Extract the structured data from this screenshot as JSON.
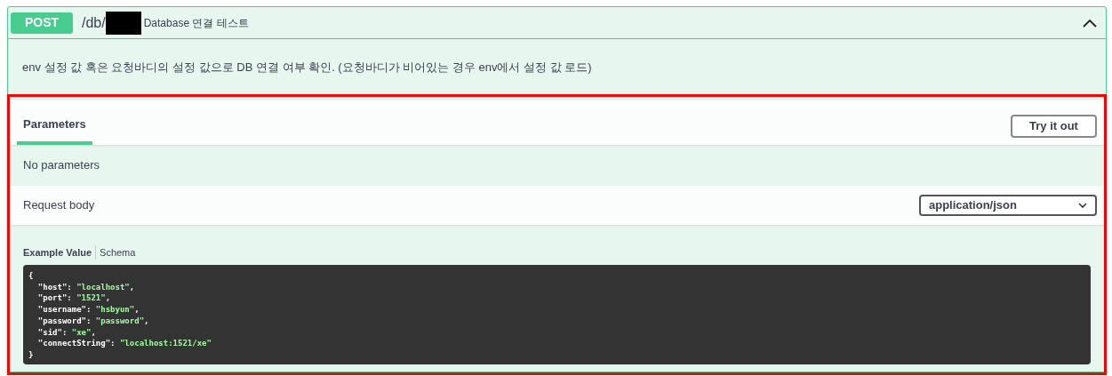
{
  "operation": {
    "method": "POST",
    "path": "/db/",
    "path_redacted": true,
    "summary": "Database 연결 테스트",
    "expanded": true
  },
  "description": "env 설정 값 혹은 요청바디의 설정 값으로 DB 연결 여부 확인. (요청바디가 비어있는 경우 env에서 설정 값 로드)",
  "tabs": [
    {
      "label": "Parameters",
      "selected": true
    }
  ],
  "try_button": "Try it out",
  "parameters_message": "No parameters",
  "request_body": {
    "label": "Request body",
    "content_type": "application/json"
  },
  "example_tabs": [
    {
      "label": "Example Value",
      "selected": true
    },
    {
      "label": "Schema",
      "selected": false
    }
  ],
  "example": {
    "open": "{",
    "close": "}",
    "lines": [
      {
        "key": "\"host\"",
        "sep": ": ",
        "value": "\"localhost\"",
        "end": ","
      },
      {
        "key": "\"port\"",
        "sep": ": ",
        "value": "\"1521\"",
        "end": ","
      },
      {
        "key": "\"username\"",
        "sep": ": ",
        "value": "\"hsbyun\"",
        "end": ","
      },
      {
        "key": "\"password\"",
        "sep": ": ",
        "value": "\"password\"",
        "end": ","
      },
      {
        "key": "\"sid\"",
        "sep": ": ",
        "value": "\"xe\"",
        "end": ","
      },
      {
        "key": "\"connectString\"",
        "sep": ": ",
        "value": "\"localhost:1521/xe\""
      }
    ]
  },
  "highlight": true
}
